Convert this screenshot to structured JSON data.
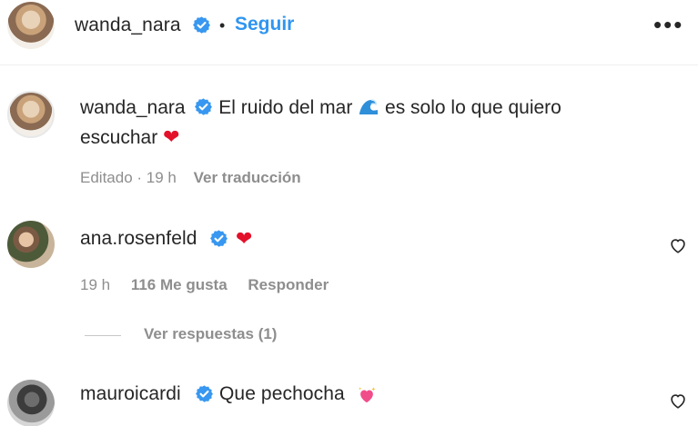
{
  "header": {
    "username": "wanda_nara",
    "separator": "•",
    "follow_label": "Seguir",
    "more_label": "•••"
  },
  "caption": {
    "username": "wanda_nara",
    "text_part1": "El ruido del mar",
    "text_part2": "es solo lo que quiero",
    "text_line2": "escuchar",
    "heart": "❤",
    "meta_edited": "Editado · 19 h",
    "translate_label": "Ver traducción"
  },
  "comments": [
    {
      "username": "ana.rosenfeld",
      "text": "",
      "emoji": "❤",
      "time": "19 h",
      "likes": "116 Me gusta",
      "reply_label": "Responder",
      "view_replies": "Ver respuestas (1)"
    },
    {
      "username": "mauroicardi",
      "text": "Que pechocha",
      "emoji": "sparkling-heart"
    }
  ],
  "colors": {
    "accent": "#2f95f0",
    "verified": "#3897f0",
    "heart": "#e3112a",
    "muted": "#8e8e8e"
  },
  "icons": [
    "verified-badge-icon",
    "wave-icon",
    "heart-icon",
    "sparkling-heart-icon",
    "like-heart-outline-icon"
  ]
}
